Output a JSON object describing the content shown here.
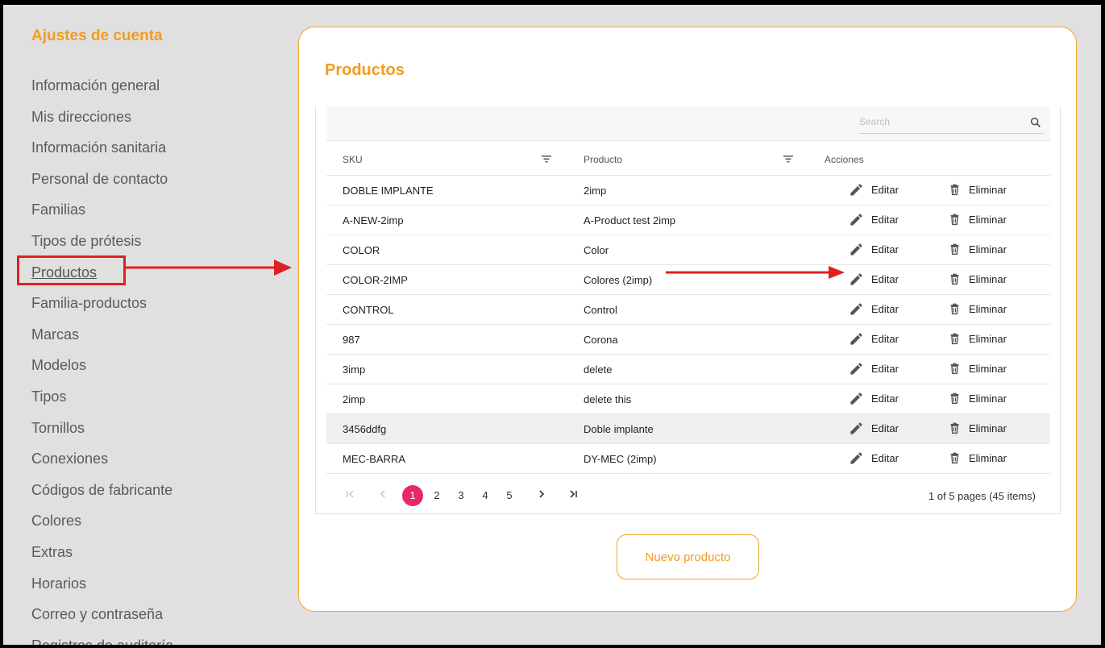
{
  "sidebar": {
    "title": "Ajustes de cuenta",
    "items": [
      {
        "label": "Información general"
      },
      {
        "label": "Mis direcciones"
      },
      {
        "label": "Información sanitaria"
      },
      {
        "label": "Personal de contacto"
      },
      {
        "label": "Familias"
      },
      {
        "label": "Tipos de prótesis"
      },
      {
        "label": "Productos",
        "active": true
      },
      {
        "label": "Familia-productos"
      },
      {
        "label": "Marcas"
      },
      {
        "label": "Modelos"
      },
      {
        "label": "Tipos"
      },
      {
        "label": "Tornillos"
      },
      {
        "label": "Conexiones"
      },
      {
        "label": "Códigos de fabricante"
      },
      {
        "label": "Colores"
      },
      {
        "label": "Extras"
      },
      {
        "label": "Horarios"
      },
      {
        "label": "Correo y contraseña"
      },
      {
        "label": "Registros de auditoría"
      }
    ]
  },
  "main": {
    "title": "Productos",
    "search_placeholder": "Search",
    "columns": {
      "sku": "SKU",
      "product": "Producto",
      "actions": "Acciones"
    },
    "edit_label": "Editar",
    "delete_label": "Eliminar",
    "rows": [
      {
        "sku": "DOBLE IMPLANTE",
        "product": "2imp"
      },
      {
        "sku": "A-NEW-2imp",
        "product": "A-Product test 2imp"
      },
      {
        "sku": "COLOR",
        "product": "Color"
      },
      {
        "sku": "COLOR-2IMP",
        "product": "Colores (2imp)"
      },
      {
        "sku": "CONTROL",
        "product": "Control"
      },
      {
        "sku": "987",
        "product": "Corona"
      },
      {
        "sku": "3imp",
        "product": "delete"
      },
      {
        "sku": "2imp",
        "product": "delete this"
      },
      {
        "sku": "3456ddfg",
        "product": "Doble implante",
        "highlighted": true
      },
      {
        "sku": "MEC-BARRA",
        "product": "DY-MEC (2imp)"
      }
    ],
    "pagination": {
      "pages": [
        "1",
        "2",
        "3",
        "4",
        "5"
      ],
      "current": "1",
      "info": "1 of 5 pages (45 items)"
    },
    "new_button_label": "Nuevo producto"
  },
  "colors": {
    "accent": "#f29c1f",
    "page_current": "#e8266a",
    "annotation": "#e02020"
  }
}
